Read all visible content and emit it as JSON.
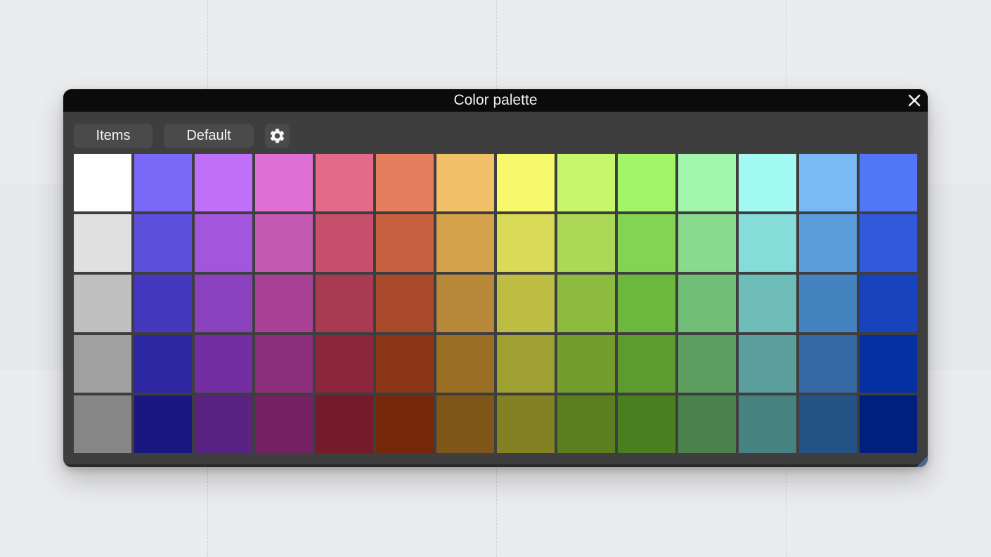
{
  "window": {
    "title": "Color palette"
  },
  "toolbar": {
    "items_label": "Items",
    "default_label": "Default"
  },
  "icons": {
    "close": "close-icon",
    "settings": "gear-icon"
  },
  "palette": [
    [
      "#ffffff",
      "#7a69f8",
      "#c06ff8",
      "#e06fd3",
      "#e46a8a",
      "#e67e5e",
      "#f2c068",
      "#f7f86b",
      "#c6f76a",
      "#a2f468",
      "#a1f5ad",
      "#a2faf3",
      "#78b9f6",
      "#5177f6"
    ],
    [
      "#e0e0e0",
      "#5c4fdb",
      "#a356dd",
      "#c25ab2",
      "#c64f6b",
      "#c6603f",
      "#d4a24a",
      "#d9da57",
      "#abd856",
      "#84d453",
      "#88da8e",
      "#85dcd8",
      "#5b9ddb",
      "#3258db"
    ],
    [
      "#c0c0c0",
      "#4438bf",
      "#8b42bf",
      "#a84194",
      "#a83a52",
      "#a84a2b",
      "#b78837",
      "#bdbd43",
      "#8dbb40",
      "#6cb83d",
      "#70be78",
      "#6fbdb8",
      "#4483c0",
      "#1843bf"
    ],
    [
      "#a0a0a0",
      "#2d28a1",
      "#722fa1",
      "#8c2e7b",
      "#8c263b",
      "#8c3618",
      "#9a6e25",
      "#9ea031",
      "#729d2d",
      "#5c9b2d",
      "#5c9f61",
      "#5a9f9c",
      "#3368a2",
      "#0530a1"
    ],
    [
      "#868686",
      "#1a1880",
      "#5a2283",
      "#732163",
      "#751a2a",
      "#762709",
      "#7e5617",
      "#828222",
      "#5a7f1f",
      "#497f1f",
      "#4b824c",
      "#46827f",
      "#235387",
      "#00207f"
    ]
  ]
}
